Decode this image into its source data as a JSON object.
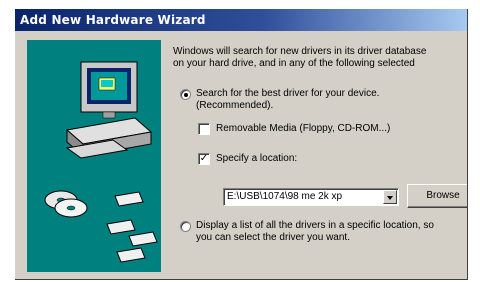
{
  "window": {
    "title": "Add New Hardware Wizard"
  },
  "intro": {
    "line1": "Windows will search for new drivers in its driver database",
    "line2": "on your hard drive, and in any of the following selected"
  },
  "options": {
    "search_best": {
      "selected": true,
      "line1": "Search for the best driver for your device.",
      "line2": "(Recommended)."
    },
    "removable_media": {
      "checked": false,
      "label": "Removable Media (Floppy, CD-ROM...)"
    },
    "specify_location": {
      "checked": true,
      "label": "Specify a location:",
      "check_glyph": "✓"
    },
    "location": {
      "value": "E:\\USB\\1074\\98 me 2k xp"
    },
    "browse": {
      "label": "Browse"
    },
    "display_list": {
      "selected": false,
      "line1": "Display a list of all the drivers in a specific location, so",
      "line2": "you can select the driver you want."
    }
  },
  "colors": {
    "title_start": "#0a246a",
    "title_end": "#a6caf0",
    "panel": "#00807f",
    "face": "#d4d0c8"
  },
  "icons": [
    "computer-icon",
    "cd-icon",
    "floppy-disk-icon"
  ]
}
